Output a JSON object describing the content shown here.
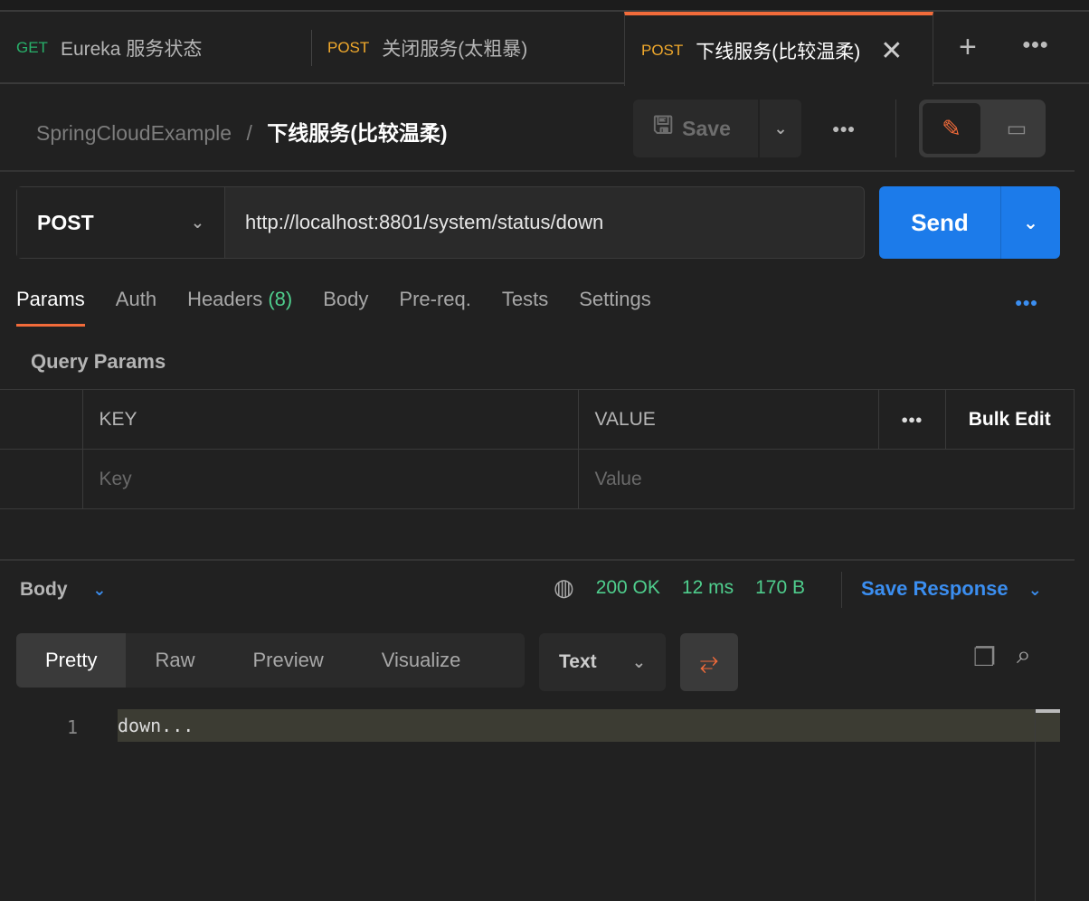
{
  "tabs": [
    {
      "method": "GET",
      "title": "Eureka 服务状态"
    },
    {
      "method": "POST",
      "title": "关闭服务(太粗暴)"
    },
    {
      "method": "POST",
      "title": "下线服务(比较温柔)",
      "active": true
    }
  ],
  "breadcrumb": {
    "collection": "SpringCloudExample",
    "separator": "/",
    "request": "下线服务(比较温柔)"
  },
  "toolbar": {
    "save_label": "Save"
  },
  "request": {
    "method": "POST",
    "url": "http://localhost:8801/system/status/down",
    "send_label": "Send"
  },
  "req_tabs": {
    "params": "Params",
    "auth": "Auth",
    "headers": "Headers",
    "headers_count": "(8)",
    "body": "Body",
    "prereq": "Pre-req.",
    "tests": "Tests",
    "settings": "Settings"
  },
  "query": {
    "title": "Query Params",
    "key_header": "KEY",
    "value_header": "VALUE",
    "bulk_edit": "Bulk Edit",
    "key_placeholder": "Key",
    "value_placeholder": "Value"
  },
  "response": {
    "body_label": "Body",
    "status": "200 OK",
    "time": "12 ms",
    "size": "170 B",
    "save_response": "Save Response",
    "views": [
      "Pretty",
      "Raw",
      "Preview",
      "Visualize"
    ],
    "format": "Text",
    "lines": [
      {
        "num": "1",
        "text": "down..."
      }
    ]
  },
  "colors": {
    "accent": "#f26b3a",
    "send": "#1c7bea",
    "success": "#4fce8d",
    "post": "#f0a92c",
    "get": "#28b06a"
  }
}
